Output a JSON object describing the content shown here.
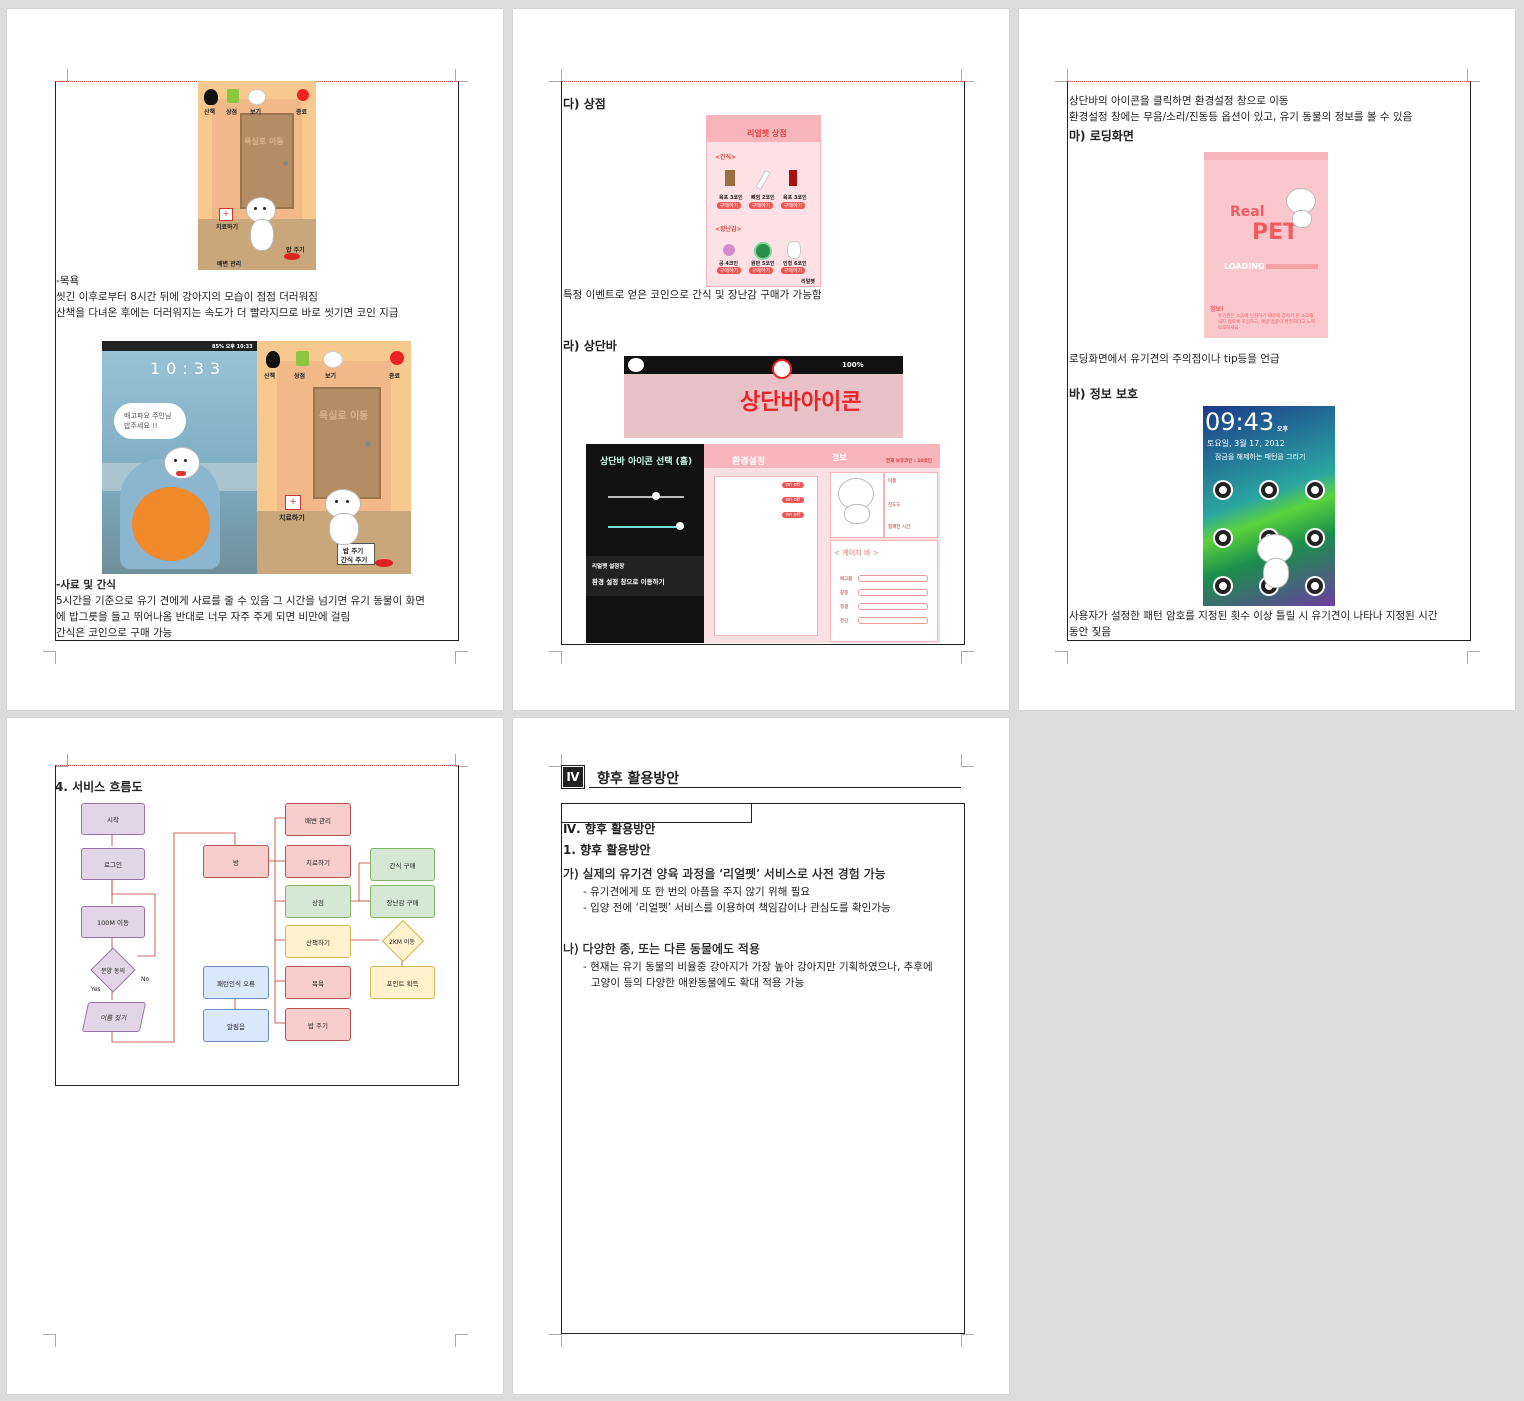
{
  "page1": {
    "game1": {
      "menu": [
        "산책",
        "상점",
        "보기",
        "종료"
      ],
      "door": "욕실로 이동",
      "heal": "치료하기",
      "food": "밥 주기",
      "poop": "배변 관리"
    },
    "bath_title": "-목욕",
    "bath_l1": "씻긴 이후로부터 8시간 뒤에 강아지의 모습이 점점 더러워짐",
    "bath_l2": "산책을 다녀온 후에는 더러워지는 속도가 더 빨라지므로 바로 씻기면 코인 지급",
    "phone": {
      "clock": "10:33",
      "status": "85% 오후 10:33",
      "bubble": "배고파요 주인님\n밥주세요 !!"
    },
    "game2": {
      "menu": [
        "산책",
        "상점",
        "보기",
        "종료"
      ],
      "door": "욕실로 이동",
      "heal": "치료하기",
      "food": "밥 주기",
      "snack": "간식 주기"
    },
    "food_title": "-사료 및 간식",
    "food_l1": "5시간을 기준으로 유기 견에게 사료를 줄 수 있음 그 시간을 넘기면 유기 동물이 화면",
    "food_l2": "에 밥그릇을 들고 뛰어나옴 반대로 너무 자주 주게 되면 비만에 걸림",
    "food_l3": "간식은 코인으로 구매 가능"
  },
  "page2": {
    "shop_title": "다) 상점",
    "shop": {
      "header": "리얼펫 상점",
      "snack": "<간식>",
      "toy": "<장난감>",
      "buy": "구매하기",
      "footer": "리얼펫",
      "items1": [
        "육포 3코인",
        "뼈껌 2코인",
        "육포 3코인"
      ],
      "items2": [
        "공 4코인",
        "원반 5코인",
        "인형 6코인"
      ]
    },
    "shop_desc": "특정 이벤트로 얻은 코인으로 간식 및 장난감 구매가 가능함",
    "bar_title": "라) 상단바",
    "statusbar": {
      "text": "100%",
      "banner": "상단바아이콘"
    },
    "panel": {
      "title": "상단바 아이콘 선택 (홈)",
      "hint_title": "리얼펫 설정창",
      "hint": "환경 설정 창으로 이동하기",
      "settings": "환경설정",
      "on_off": "on off",
      "info": "정보",
      "coin": "현재 보유코인 : 10코인",
      "fields": [
        "이름",
        "진도도",
        "함께한 시간"
      ],
      "gauge_title": "< 게이지 바 >",
      "gauges": [
        "배고픔",
        "갈증",
        "청결",
        "건강"
      ]
    }
  },
  "page3": {
    "l1": "상단바의 아이콘을 클릭하면 환경설정 창으로 이동",
    "l2": "환경설정 창에는 무음/소리/진동등 옵션이 있고, 유기 동물의 정보를 볼 수 있음",
    "loading_title": "마) 로딩화면",
    "loading": {
      "real": "Real",
      "pet": "PET",
      "loading": "LOADING",
      "tip_title": "정보!",
      "tip": "유기견은 소음에 민감하기 때문에 갑자기 큰 소리를 내지 않도록 조심하고, 예방 접종이 완전하다고 느껴 보호하세요"
    },
    "loading_desc": "로딩화면에서 유기견의 주의점이나 tip등을 언급",
    "privacy_title": "바) 정보 보호",
    "lock": {
      "time": "09:43",
      "ampm": "오후",
      "date": "토요일, 3월 17, 2012",
      "msg": "잠금을 해제하는 패턴을 그리기"
    },
    "privacy_l1": "사용자가 설정한 패턴 암호를 지정된 횟수 이상 틀릴 시 유기견이 나타나 지정된 시간",
    "privacy_l2": "동안 짖음"
  },
  "page4": {
    "title": "4. 서비스 흐름도",
    "flow": {
      "start": "시작",
      "login": "로그인",
      "move": "100M 이동",
      "found": "분양 동의",
      "search": "이름 짓기",
      "room": "방",
      "poop": "배변 관리",
      "heal": "치료하기",
      "shop": "상점",
      "walk": "산책하기",
      "bath": "목욕",
      "feed": "밥 주기",
      "snack": "간식 구매",
      "toy": "장난감 구매",
      "km": "2KM 이동",
      "point": "포인트 획득",
      "pattern": "패턴인식 오류",
      "alarm": "알림음",
      "yes": "Yes",
      "no": "No"
    }
  },
  "page5": {
    "badge": "Ⅳ",
    "section": "향후 활용방안",
    "h1": "Ⅳ. 향후 활용방안",
    "h2": "1. 향후 활용방안",
    "a_title": "가) 실제의 유기견 양육 과정을 ‘리얼펫’ 서비스로 사전 경험 가능",
    "a1": "- 유기견에게 또 한 번의 아픔을 주지 않기 위해 필요",
    "a2": "- 입양 전에 ‘리얼펫’ 서비스를 이용하여 책임감이나 관심도를 확인가능",
    "b_title": "나) 다양한 종, 또는 다른 동물에도 적용",
    "b1": "- 현재는 유기 동물의 비율중 강아지가 가장 높아 강아지만 기획하였으나, 추후에",
    "b2": "고양이 등의 다양한 애완동물에도 확대 적용 가능"
  }
}
